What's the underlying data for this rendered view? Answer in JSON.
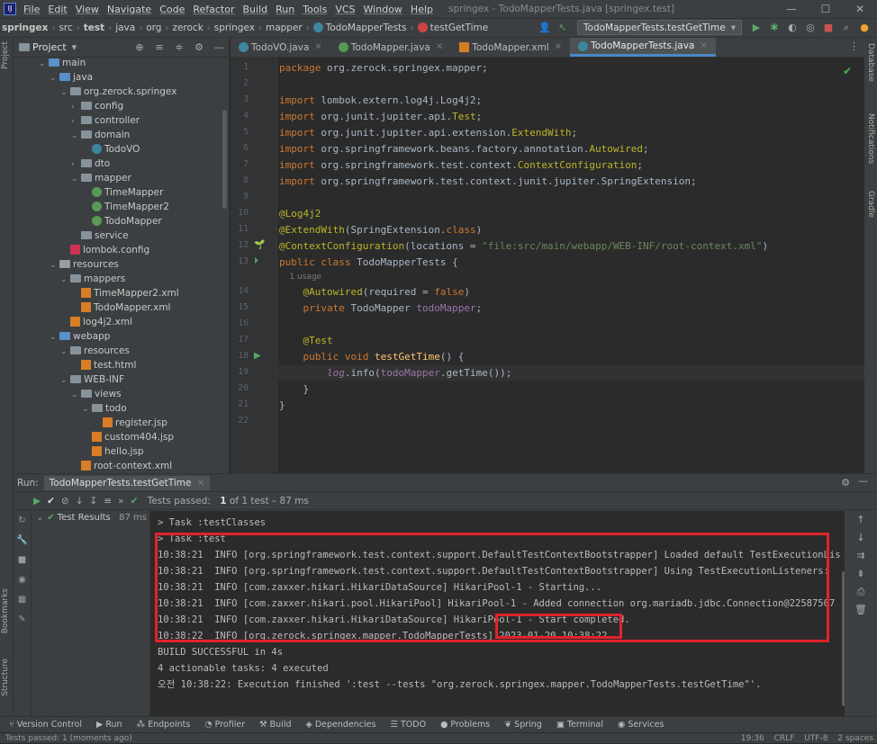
{
  "menu": {
    "items": [
      "File",
      "Edit",
      "View",
      "Navigate",
      "Code",
      "Refactor",
      "Build",
      "Run",
      "Tools",
      "VCS",
      "Window",
      "Help"
    ],
    "window_title": "springex - TodoMapperTests.java [springex.test]"
  },
  "nav": {
    "crumbs": [
      "springex",
      "src",
      "test",
      "java",
      "org",
      "zerock",
      "springex",
      "mapper",
      "TodoMapperTests",
      "testGetTime"
    ],
    "run_config": "TodoMapperTests.testGetTime"
  },
  "side": {
    "left": [
      "Project",
      "Bookmarks",
      "Structure"
    ],
    "right": [
      "Database",
      "Notifications",
      "Gradle"
    ]
  },
  "project": {
    "title": "Project",
    "tree": [
      {
        "label": "main",
        "indent": 0,
        "arrow": "⌄",
        "icon": "src"
      },
      {
        "label": "java",
        "indent": 1,
        "arrow": "⌄",
        "icon": "src"
      },
      {
        "label": "org.zerock.springex",
        "indent": 2,
        "arrow": "⌄",
        "icon": "fold"
      },
      {
        "label": "config",
        "indent": 3,
        "arrow": "›",
        "icon": "fold"
      },
      {
        "label": "controller",
        "indent": 3,
        "arrow": "›",
        "icon": "fold"
      },
      {
        "label": "domain",
        "indent": 3,
        "arrow": "⌄",
        "icon": "fold"
      },
      {
        "label": "TodoVO",
        "indent": 4,
        "arrow": "",
        "icon": "class"
      },
      {
        "label": "dto",
        "indent": 3,
        "arrow": "›",
        "icon": "fold"
      },
      {
        "label": "mapper",
        "indent": 3,
        "arrow": "⌄",
        "icon": "fold"
      },
      {
        "label": "TimeMapper",
        "indent": 4,
        "arrow": "",
        "icon": "iface"
      },
      {
        "label": "TimeMapper2",
        "indent": 4,
        "arrow": "",
        "icon": "iface"
      },
      {
        "label": "TodoMapper",
        "indent": 4,
        "arrow": "",
        "icon": "iface"
      },
      {
        "label": "service",
        "indent": 3,
        "arrow": "",
        "icon": "fold"
      },
      {
        "label": "lombok.config",
        "indent": 2,
        "arrow": "",
        "icon": "cfg"
      },
      {
        "label": "resources",
        "indent": 1,
        "arrow": "⌄",
        "icon": "res"
      },
      {
        "label": "mappers",
        "indent": 2,
        "arrow": "⌄",
        "icon": "fold"
      },
      {
        "label": "TimeMapper2.xml",
        "indent": 3,
        "arrow": "",
        "icon": "xml"
      },
      {
        "label": "TodoMapper.xml",
        "indent": 3,
        "arrow": "",
        "icon": "xml"
      },
      {
        "label": "log4j2.xml",
        "indent": 2,
        "arrow": "",
        "icon": "xml"
      },
      {
        "label": "webapp",
        "indent": 1,
        "arrow": "⌄",
        "icon": "src"
      },
      {
        "label": "resources",
        "indent": 2,
        "arrow": "⌄",
        "icon": "fold"
      },
      {
        "label": "test.html",
        "indent": 3,
        "arrow": "",
        "icon": "htm"
      },
      {
        "label": "WEB-INF",
        "indent": 2,
        "arrow": "⌄",
        "icon": "fold"
      },
      {
        "label": "views",
        "indent": 3,
        "arrow": "⌄",
        "icon": "fold"
      },
      {
        "label": "todo",
        "indent": 4,
        "arrow": "⌄",
        "icon": "fold"
      },
      {
        "label": "register.jsp",
        "indent": 5,
        "arrow": "",
        "icon": "htm"
      },
      {
        "label": "custom404.jsp",
        "indent": 4,
        "arrow": "",
        "icon": "htm"
      },
      {
        "label": "hello.jsp",
        "indent": 4,
        "arrow": "",
        "icon": "htm"
      },
      {
        "label": "root-context.xml",
        "indent": 3,
        "arrow": "",
        "icon": "xml"
      }
    ]
  },
  "tabs": [
    {
      "label": "TodoVO.java",
      "icon": "class",
      "active": false
    },
    {
      "label": "TodoMapper.java",
      "icon": "iface",
      "active": false
    },
    {
      "label": "TodoMapper.xml",
      "icon": "xml",
      "active": false
    },
    {
      "label": "TodoMapperTests.java",
      "icon": "class",
      "active": true
    }
  ],
  "editor": {
    "usage_hint": "1 usage",
    "lines": [
      {
        "n": "1",
        "html": "<span class=\"kw\">package</span> org.zerock.springex.mapper;"
      },
      {
        "n": "2",
        "html": ""
      },
      {
        "n": "3",
        "html": "<span class=\"kw\">import</span> lombok.extern.log4j.Log4j2;"
      },
      {
        "n": "4",
        "html": "<span class=\"kw\">import</span> org.junit.jupiter.api.<span class=\"an\">Test</span>;"
      },
      {
        "n": "5",
        "html": "<span class=\"kw\">import</span> org.junit.jupiter.api.extension.<span class=\"an\">ExtendWith</span>;"
      },
      {
        "n": "6",
        "html": "<span class=\"kw\">import</span> org.springframework.beans.factory.annotation.<span class=\"an\">Autowired</span>;"
      },
      {
        "n": "7",
        "html": "<span class=\"kw\">import</span> org.springframework.test.context.<span class=\"an\">ContextConfiguration</span>;"
      },
      {
        "n": "8",
        "html": "<span class=\"kw\">import</span> org.springframework.test.context.junit.jupiter.SpringExtension;"
      },
      {
        "n": "9",
        "html": ""
      },
      {
        "n": "10",
        "html": "<span class=\"an\">@Log4j2</span>"
      },
      {
        "n": "11",
        "html": "<span class=\"an\">@ExtendWith</span>(SpringExtension.<span class=\"kw\">class</span>)"
      },
      {
        "n": "12",
        "html": "<span class=\"an\">@ContextConfiguration</span>(locations = <span class=\"st\">\"file:src/main/webapp/WEB-INF/root-context.xml\"</span>)"
      },
      {
        "n": "13",
        "html": "<span class=\"kw\">public class</span> TodoMapperTests {"
      },
      {
        "n": "14",
        "html": "    <span class=\"an\">@Autowired</span>(required = <span class=\"kw\">false</span>)"
      },
      {
        "n": "15",
        "html": "    <span class=\"kw\">private</span> TodoMapper <span class=\"fd\">todoMapper</span>;"
      },
      {
        "n": "16",
        "html": ""
      },
      {
        "n": "17",
        "html": "    <span class=\"an\">@Test</span>"
      },
      {
        "n": "18",
        "html": "    <span class=\"kw\">public void</span> <span class=\"fn\">testGetTime</span>() {"
      },
      {
        "n": "19",
        "html": "        <span class=\"sp\">log</span>.info(<span class=\"fd\">todoMapper</span>.getTime());"
      },
      {
        "n": "20",
        "html": "    }"
      },
      {
        "n": "21",
        "html": "}"
      },
      {
        "n": "22",
        "html": ""
      }
    ]
  },
  "run": {
    "label": "Run:",
    "tab": "TodoMapperTests.testGetTime",
    "passed_prefix": "Tests passed:",
    "passed_count": "1",
    "passed_suffix": "of 1 test – 87 ms",
    "tree_root": "Test Results",
    "tree_time": "87 ms",
    "console": [
      "> Task :testClasses",
      "> Task :test",
      "10:38:21  INFO [org.springframework.test.context.support.DefaultTestContextBootstrapper] Loaded default TestExecutionLis",
      "10:38:21  INFO [org.springframework.test.context.support.DefaultTestContextBootstrapper] Using TestExecutionListeners:",
      "10:38:21  INFO [com.zaxxer.hikari.HikariDataSource] HikariPool-1 - Starting...",
      "10:38:21  INFO [com.zaxxer.hikari.pool.HikariPool] HikariPool-1 - Added connection org.mariadb.jdbc.Connection@22587507",
      "10:38:21  INFO [com.zaxxer.hikari.HikariDataSource] HikariPool-1 - Start completed.",
      "10:38:22  INFO [org.zerock.springex.mapper.TodoMapperTests] 2023-01-20 10:38:22",
      "BUILD SUCCESSFUL in 4s",
      "4 actionable tasks: 4 executed",
      "오전 10:38:22: Execution finished ':test --tests \"org.zerock.springex.mapper.TodoMapperTests.testGetTime\"'."
    ]
  },
  "bottom": {
    "tabs": [
      "Version Control",
      "Run",
      "Endpoints",
      "Profiler",
      "Build",
      "Dependencies",
      "TODO",
      "Problems",
      "Spring",
      "Terminal",
      "Services"
    ]
  },
  "status": {
    "message": "Tests passed: 1 (moments ago)",
    "position": "19:36",
    "line_sep": "CRLF",
    "encoding": "UTF-8",
    "indent": "2 spaces"
  }
}
